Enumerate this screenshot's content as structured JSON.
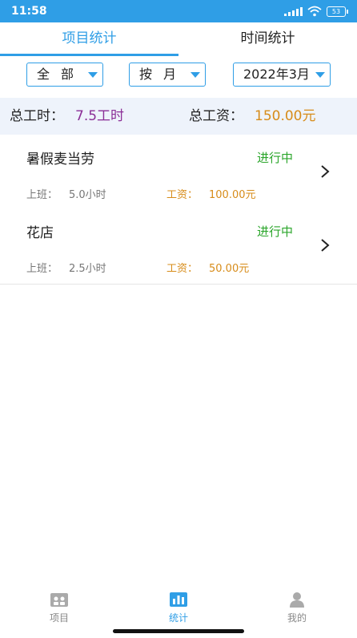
{
  "status_bar": {
    "time": "11:58",
    "battery": "53"
  },
  "tabs": [
    {
      "label": "项目统计",
      "active": true
    },
    {
      "label": "时间统计",
      "active": false
    }
  ],
  "filters": {
    "category": "全部",
    "period": "按月",
    "month": "2022年3月"
  },
  "summary": {
    "hours_label": "总工时：",
    "hours_value": "7.5工时",
    "wage_label": "总工资：",
    "wage_value": "150.00元"
  },
  "projects": [
    {
      "name": "暑假麦当劳",
      "status": "进行中",
      "work_label": "上班：",
      "work_value": "5.0小时",
      "pay_label": "工资：",
      "pay_value": "100.00元"
    },
    {
      "name": "花店",
      "status": "进行中",
      "work_label": "上班：",
      "work_value": "2.5小时",
      "pay_label": "工资：",
      "pay_value": "50.00元"
    }
  ],
  "bottom_nav": [
    {
      "label": "项目",
      "icon": "project-icon",
      "active": false
    },
    {
      "label": "统计",
      "icon": "chart-icon",
      "active": true
    },
    {
      "label": "我的",
      "icon": "user-icon",
      "active": false
    }
  ],
  "colors": {
    "accent": "#2f9ee6",
    "status_green": "#2aa52a",
    "wage_orange": "#d78c1a",
    "hours_purple": "#8b2f97",
    "summary_bg": "#eef3fb"
  }
}
